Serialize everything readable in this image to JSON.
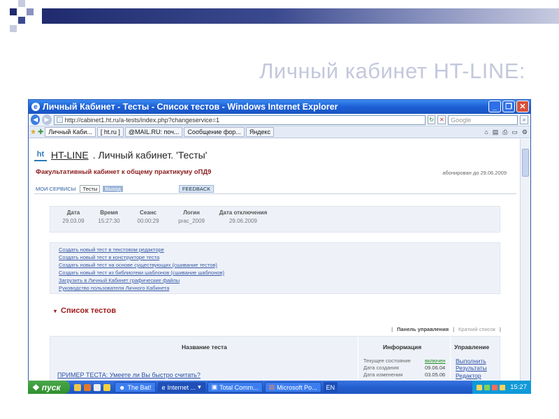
{
  "slide": {
    "title": "Личный кабинет HT-LINE:"
  },
  "window": {
    "title": "Личный Кабинет - Тесты - Список тестов - Windows Internet Explorer",
    "address": "http://cabinet1.ht.ru/a-tests/index.php?changeservice=1",
    "search_placeholder": "Google",
    "tabs": [
      {
        "label": "Личный Каби..."
      },
      {
        "label": "[ ht.ru ]"
      },
      {
        "label": "@MAIL.RU: поч..."
      },
      {
        "label": "Сообщение фор..."
      },
      {
        "label": "Яндекс"
      }
    ]
  },
  "page": {
    "brand": "HT-LINE",
    "header_rest": ". Личный кабинет. 'Тесты'",
    "subtitle": "Факультативный кабинет к общему практикуму оПД9",
    "subscription": "абонирован до 29.06.2009",
    "menu": {
      "services": "МОИ СЕРВИСЫ",
      "tests": "Тесты",
      "exit": "Выход",
      "feedback": "FEEDBACK"
    },
    "info": [
      {
        "label": "Дата",
        "value": "29.03.09"
      },
      {
        "label": "Время",
        "value": "15:27:30"
      },
      {
        "label": "Сеанс",
        "value": "00:00:29"
      },
      {
        "label": "Логин",
        "value": "prac_2009"
      },
      {
        "label": "Дата отключения",
        "value": "29.06.2009"
      }
    ],
    "links": [
      "Создать новый тест в текстовом редакторе",
      "Создать новый тест в конструкторе теста",
      "Создать новый тест на основе существующих (сшивание тестов)",
      "Создать новый тест из библиотеки шаблонов (сшивание шаблонов)",
      "Загрузить в Личный Кабинет графические файлы",
      "Руководство пользователя Личного Кабинета"
    ],
    "list_title": "Список тестов",
    "control": {
      "panel": "Панель управления",
      "short": "Краткий список"
    },
    "table": {
      "col_name": "Название теста",
      "col_info": "Информация",
      "col_manage": "Управление",
      "row": {
        "name": "ПРИМЕР ТЕСТА: Умеете ли Вы быстро считать?",
        "state_label": "Текущее состояние",
        "state_value": "включен",
        "created_label": "Дата создания",
        "created_value": "09.06.04",
        "changed_label": "Дата изменения",
        "changed_value": "03.05.06",
        "run": "Выполнить",
        "results": "Результаты",
        "editor": "Редактор"
      }
    }
  },
  "taskbar": {
    "start": "пуск",
    "tasks": [
      {
        "label": "The Bat!"
      },
      {
        "label": "Internet ..."
      },
      {
        "label": "Total Comm..."
      },
      {
        "label": "Microsoft Po..."
      }
    ],
    "lang": "EN",
    "clock": "15:27"
  }
}
